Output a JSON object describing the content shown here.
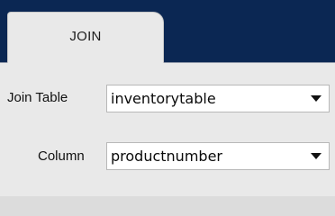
{
  "tabs": [
    {
      "label": "JOIN",
      "active": true
    }
  ],
  "form": {
    "join_table": {
      "label": "Join Table",
      "value": "inventorytable"
    },
    "column": {
      "label": "Column",
      "value": "productnumber"
    }
  },
  "icons": {
    "dropdown": "chevron-down-icon"
  },
  "colors": {
    "header_bg": "#0b2753",
    "panel_bg": "#e9e9e9",
    "input_bg": "#ffffff"
  }
}
